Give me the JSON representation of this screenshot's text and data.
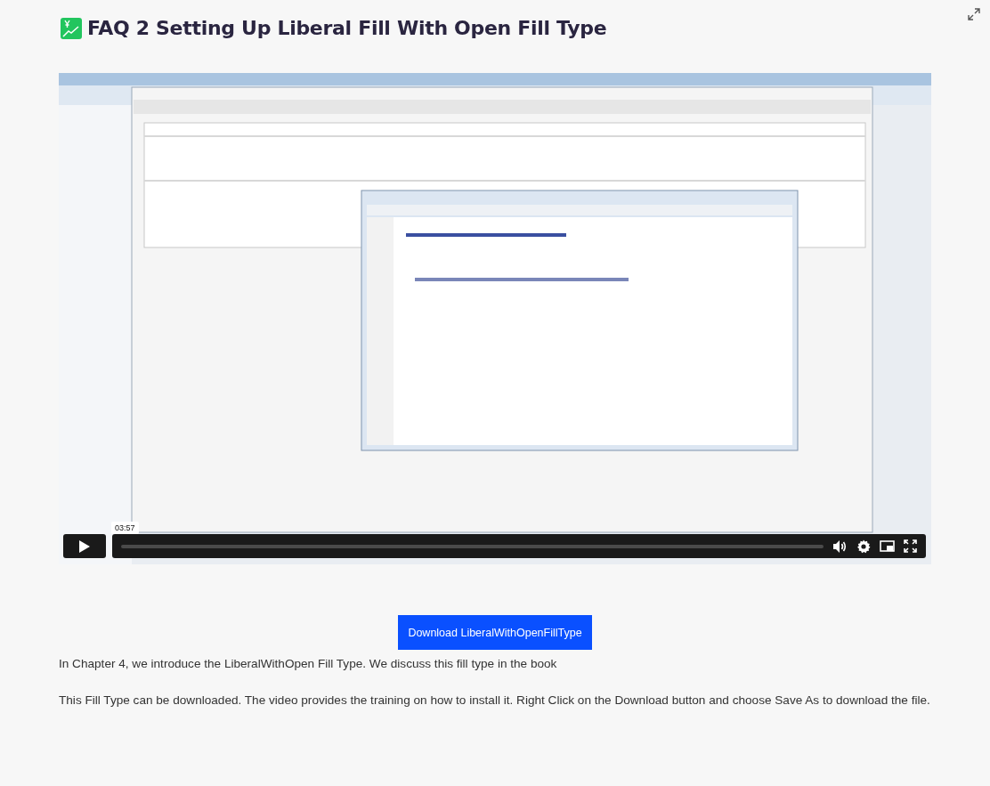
{
  "title": "FAQ 2 Setting Up Liberal Fill With Open Fill Type",
  "video": {
    "kind": "picture",
    "time_tooltip": "03:57"
  },
  "download_button": "Download LiberalWithOpenFillType",
  "paragraphs": [
    "In Chapter 4, we introduce the LiberalWithOpen Fill Type. We discuss this fill type in the book",
    "This Fill Type can be downloaded. The video provides the training on how to install it. Right Click on the Download button and choose Save As to download the file."
  ]
}
